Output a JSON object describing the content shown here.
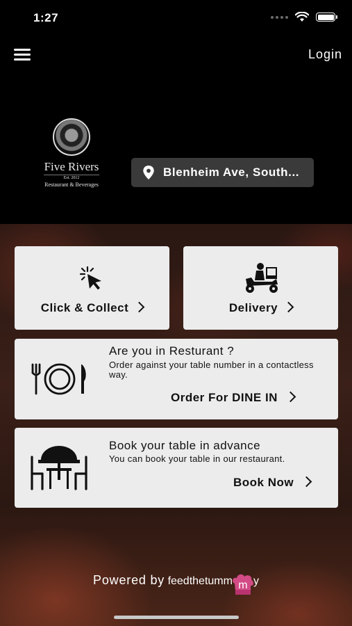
{
  "status_bar": {
    "time": "1:27"
  },
  "header": {
    "login_label": "Login"
  },
  "logo": {
    "name": "Five Rivers",
    "established": "Est. 2012",
    "tagline": "Restaurant & Beverages"
  },
  "location": {
    "text": "Blenheim Ave, South..."
  },
  "cards": {
    "click_collect": {
      "label": "Click & Collect"
    },
    "delivery": {
      "label": "Delivery"
    },
    "dine_in": {
      "heading": "Are you in Resturant ?",
      "description": "Order against your table number in a contactless way.",
      "action": "Order For DINE IN"
    },
    "book_table": {
      "heading": "Book your table in advance",
      "description": "You can book your table in our restaurant.",
      "action": "Book Now"
    }
  },
  "footer": {
    "powered_by": "Powered by",
    "brand_pre": "feedthetumm",
    "brand_mid": "m",
    "brand_post": "y"
  },
  "icons": [
    "hamburger-icon",
    "location-pin-icon",
    "cursor-click-icon",
    "delivery-scooter-icon",
    "plate-cutlery-icon",
    "table-chairs-icon",
    "chevron-right-icon"
  ]
}
